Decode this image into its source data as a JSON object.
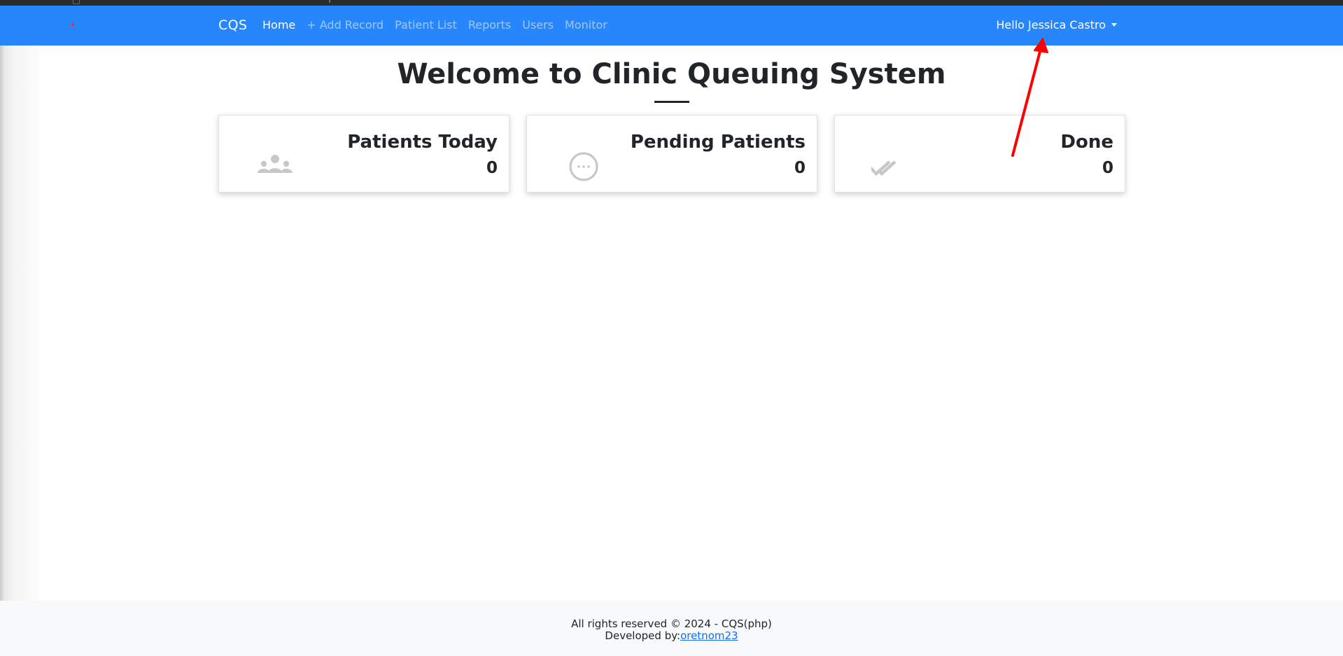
{
  "navbar": {
    "brand": "CQS",
    "items": [
      {
        "label": "Home",
        "active": true
      },
      {
        "label": "+ Add Record",
        "active": false
      },
      {
        "label": "Patient List",
        "active": false
      },
      {
        "label": "Reports",
        "active": false
      },
      {
        "label": "Users",
        "active": false
      },
      {
        "label": "Monitor",
        "active": false
      }
    ],
    "user_menu_label": "Hello Jessica Castro",
    "bg_color": "#2786fb"
  },
  "main": {
    "title": "Welcome to Clinic Queuing System",
    "cards": [
      {
        "title": "Patients Today",
        "value": "0",
        "icon": "users-icon"
      },
      {
        "title": "Pending Patients",
        "value": "0",
        "icon": "pending-dots-icon"
      },
      {
        "title": "Done",
        "value": "0",
        "icon": "double-check-icon"
      }
    ]
  },
  "footer": {
    "copyright": "All rights reserved © 2024 - CQS(php)",
    "developed_by_prefix": "Developed by:",
    "developer_link": "oretnom23"
  },
  "annotation": {
    "color": "#ff0000"
  }
}
